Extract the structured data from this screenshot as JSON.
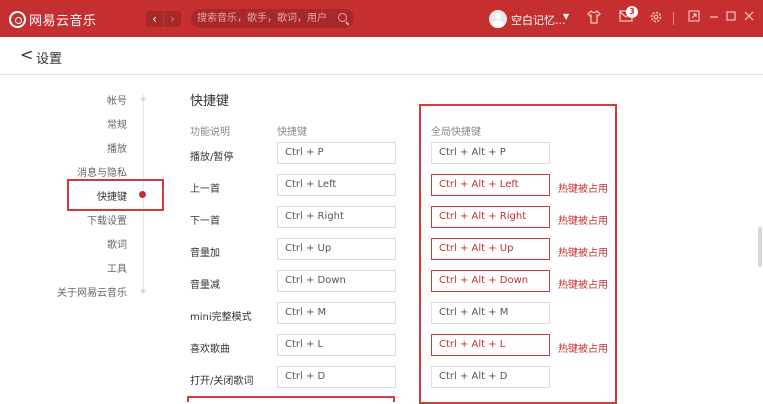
{
  "app": {
    "title": "网易云音乐"
  },
  "titlebar": {
    "nav_back": "‹",
    "nav_forward": "›",
    "search_placeholder": "搜索音乐，歌手，歌词，用户",
    "username": "空白记忆...",
    "message_count": "3",
    "icons": [
      "back-icon",
      "forward-icon",
      "search-icon",
      "avatar",
      "tshirt-icon",
      "mail-icon",
      "gear-icon",
      "mini-mode-icon",
      "minimize-icon",
      "maximize-icon",
      "close-icon"
    ]
  },
  "header": {
    "back": "<",
    "title": "设置"
  },
  "sidebar": {
    "items": [
      {
        "label": "帐号"
      },
      {
        "label": "常规"
      },
      {
        "label": "播放"
      },
      {
        "label": "消息与隐私"
      },
      {
        "label": "快捷键",
        "active": true
      },
      {
        "label": "下载设置"
      },
      {
        "label": "歌词"
      },
      {
        "label": "工具"
      },
      {
        "label": "关于网易云音乐"
      }
    ]
  },
  "shortcuts": {
    "title": "快捷键",
    "col_function": "功能说明",
    "col_shortcut": "快捷键",
    "col_global": "全局快捷键",
    "conflict_label": "热键被占用",
    "rows": [
      {
        "label": "播放/暂停",
        "key": "Ctrl + P",
        "global": "Ctrl + Alt + P",
        "conflict": false
      },
      {
        "label": "上一首",
        "key": "Ctrl + Left",
        "global": "Ctrl + Alt + Left",
        "conflict": true
      },
      {
        "label": "下一首",
        "key": "Ctrl + Right",
        "global": "Ctrl + Alt + Right",
        "conflict": true
      },
      {
        "label": "音量加",
        "key": "Ctrl + Up",
        "global": "Ctrl + Alt + Up",
        "conflict": true
      },
      {
        "label": "音量减",
        "key": "Ctrl + Down",
        "global": "Ctrl + Alt + Down",
        "conflict": true
      },
      {
        "label": "mini完整模式",
        "key": "Ctrl + M",
        "global": "Ctrl + Alt + M",
        "conflict": false
      },
      {
        "label": "喜欢歌曲",
        "key": "Ctrl + L",
        "global": "Ctrl + Alt + L",
        "conflict": true
      },
      {
        "label": "打开/关闭歌词",
        "key": "Ctrl + D",
        "global": "Ctrl + Alt + D",
        "conflict": false
      }
    ]
  },
  "colors": {
    "brand": "#c62f2f",
    "highlight_border": "#d33a3a"
  }
}
